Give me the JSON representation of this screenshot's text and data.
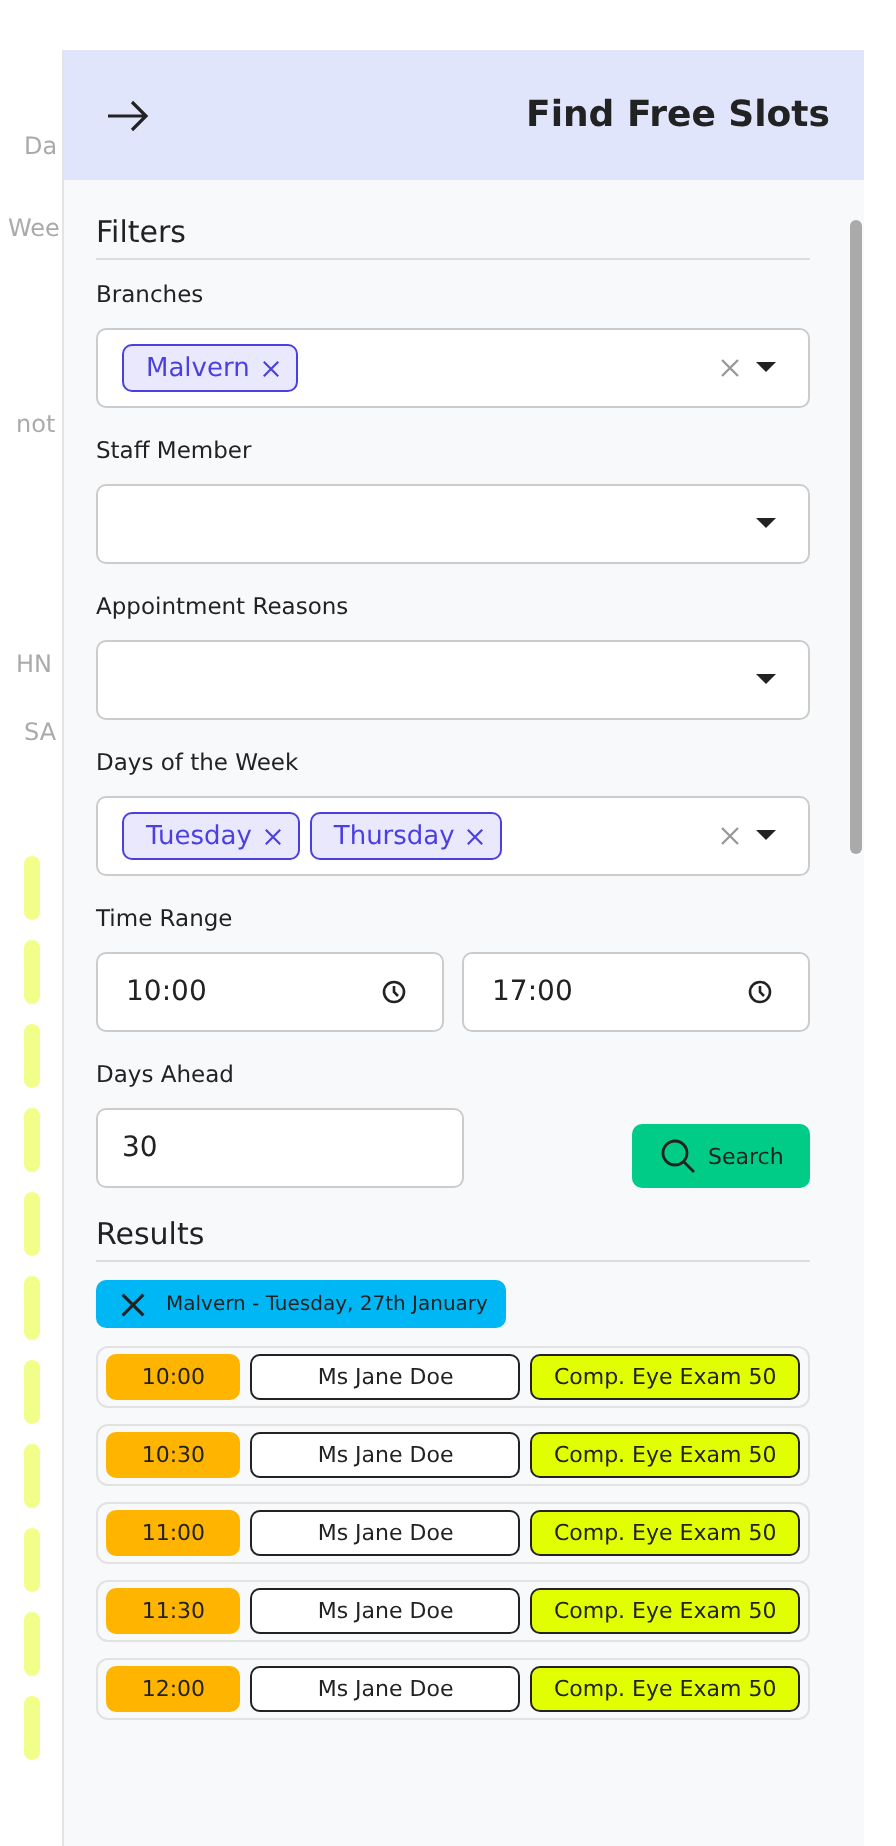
{
  "background_page": {
    "labels": [
      "Da",
      "Wee",
      "not",
      "HN",
      "SA"
    ]
  },
  "panel": {
    "title": "Find Free Slots"
  },
  "filters": {
    "heading": "Filters",
    "fields": [
      {
        "kind": "multiselect",
        "label": "Branches",
        "tags": [
          "Malvern"
        ]
      },
      {
        "kind": "select",
        "label": "Staff Member"
      },
      {
        "kind": "select",
        "label": "Appointment Reasons"
      },
      {
        "kind": "multiselect",
        "label": "Days of the Week",
        "tags": [
          "Tuesday",
          "Thursday"
        ]
      },
      {
        "kind": "timerange",
        "label": "Time Range",
        "from": "10:00",
        "to": "17:00"
      },
      {
        "kind": "number",
        "label": "Days Ahead",
        "value": "30"
      }
    ],
    "search_button": "Search"
  },
  "results": {
    "heading": "Results",
    "group": "Malvern - Tuesday, 27th January",
    "slots": [
      {
        "time": "10:00",
        "staff": "Ms Jane Doe",
        "reason": "Comp. Eye Exam 50"
      },
      {
        "time": "10:30",
        "staff": "Ms Jane Doe",
        "reason": "Comp. Eye Exam 50"
      },
      {
        "time": "11:00",
        "staff": "Ms Jane Doe",
        "reason": "Comp. Eye Exam 50"
      },
      {
        "time": "11:30",
        "staff": "Ms Jane Doe",
        "reason": "Comp. Eye Exam 50"
      },
      {
        "time": "12:00",
        "staff": "Ms Jane Doe",
        "reason": "Comp. Eye Exam 50"
      }
    ]
  }
}
